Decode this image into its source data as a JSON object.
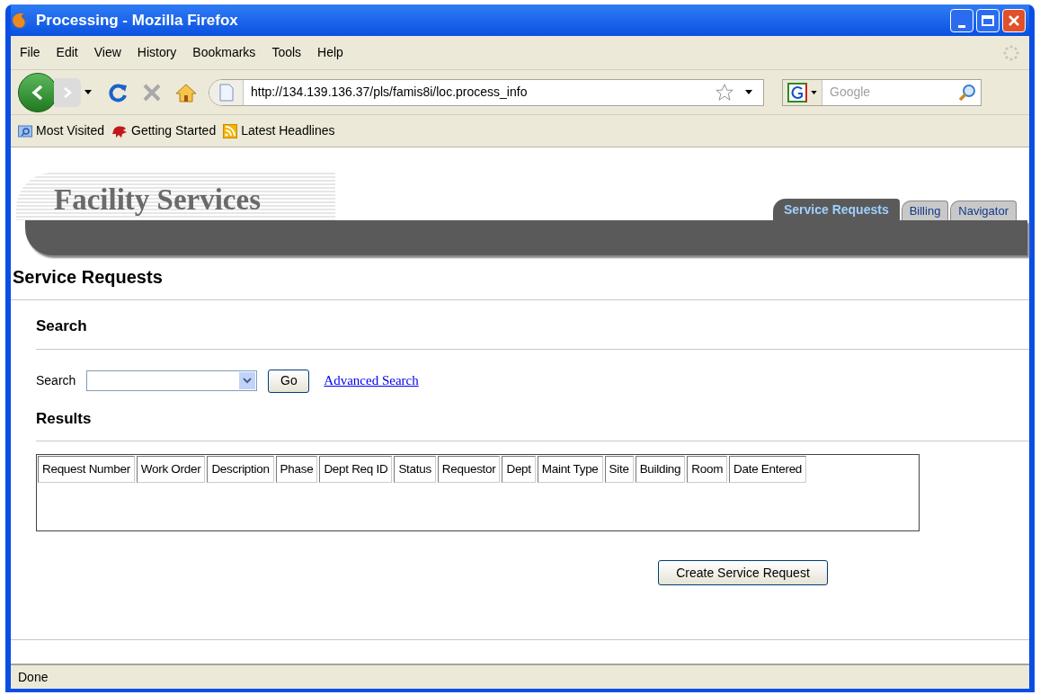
{
  "window": {
    "title": "Processing - Mozilla Firefox"
  },
  "menu": [
    "File",
    "Edit",
    "View",
    "History",
    "Bookmarks",
    "Tools",
    "Help"
  ],
  "address_bar": {
    "url": "http://134.139.136.37/pls/famis8i/loc.process_info"
  },
  "search_bar": {
    "placeholder": "Google"
  },
  "bookmarks": [
    {
      "label": "Most Visited",
      "kind": "folder"
    },
    {
      "label": "Getting Started",
      "kind": "page"
    },
    {
      "label": "Latest Headlines",
      "kind": "feed"
    }
  ],
  "site": {
    "logo": "Facility Services",
    "tabs": [
      {
        "label": "Service Requests",
        "selected": true
      },
      {
        "label": "Billing",
        "selected": false
      },
      {
        "label": "Navigator",
        "selected": false
      }
    ]
  },
  "page_title": "Service Requests",
  "search_section": {
    "heading": "Search",
    "label": "Search",
    "button": "Go",
    "link": "Advanced Search"
  },
  "results": {
    "heading": "Results",
    "columns": [
      "Request Number",
      "Work Order",
      "Description",
      "Phase",
      "Dept Req ID",
      "Status",
      "Requestor",
      "Dept",
      "Maint Type",
      "Site",
      "Building",
      "Room",
      "Date Entered"
    ]
  },
  "create_button": "Create Service Request",
  "status_bar": "Done"
}
